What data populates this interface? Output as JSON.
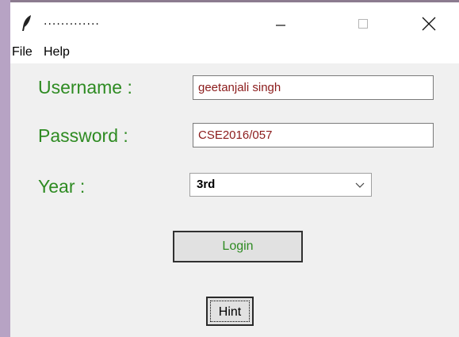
{
  "window": {
    "title": ".............",
    "controls": {
      "minimize_icon": "minimize-icon",
      "maximize_icon": "maximize-icon",
      "close_icon": "close-icon"
    }
  },
  "menubar": {
    "items": [
      {
        "label": "File"
      },
      {
        "label": "Help"
      }
    ]
  },
  "form": {
    "username_label": "Username :",
    "username_value": "geetanjali singh",
    "password_label": "Password :",
    "password_value": "CSE2016/057",
    "year_label": "Year :",
    "year_value": "3rd",
    "login_label": "Login",
    "hint_label": "Hint"
  },
  "colors": {
    "label_green": "#2e8b22",
    "entry_text": "#8b1b1b",
    "client_bg": "#f0f0f0"
  }
}
